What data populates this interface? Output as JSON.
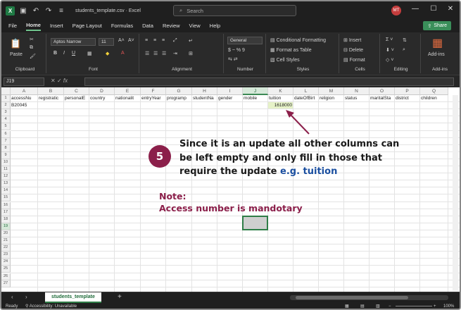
{
  "app": {
    "logo_letter": "X",
    "document_title": "students_template.csv  ·  Excel",
    "search_placeholder": "Search",
    "user_initials": "MT",
    "window_controls": [
      "—",
      "☐",
      "✕"
    ]
  },
  "menu": {
    "tabs": [
      "File",
      "Home",
      "Insert",
      "Page Layout",
      "Formulas",
      "Data",
      "Review",
      "View",
      "Help"
    ],
    "active_tab": "Home",
    "share_label": "Share"
  },
  "ribbon": {
    "clipboard": {
      "label": "Clipboard",
      "paste": "Paste"
    },
    "font": {
      "label": "Font",
      "font_name": "Aptos Narrow",
      "font_size": "11"
    },
    "alignment": {
      "label": "Alignment"
    },
    "number": {
      "label": "Number",
      "format": "General",
      "symbols": "$ ~ %  9"
    },
    "styles": {
      "label": "Styles",
      "items": [
        "Conditional Formatting",
        "Format as Table",
        "Cell Styles"
      ]
    },
    "cells": {
      "label": "Cells",
      "items": [
        "Insert",
        "Delete",
        "Format"
      ]
    },
    "editing": {
      "label": "Editing"
    },
    "addins": {
      "label": "Add-ins",
      "button": "Add-ins"
    }
  },
  "formula_bar": {
    "name_box": "J19",
    "fx_symbol": "fx",
    "value": ""
  },
  "sheet": {
    "columns": [
      "A",
      "B",
      "C",
      "D",
      "E",
      "F",
      "G",
      "H",
      "I",
      "J",
      "K",
      "L",
      "M",
      "N",
      "O",
      "P",
      "Q"
    ],
    "selected_column": "J",
    "selected_row": 19,
    "rows": [
      1,
      2,
      3,
      4,
      5,
      6,
      7,
      8,
      9,
      10,
      11,
      12,
      13,
      14,
      15,
      16,
      17,
      18,
      19,
      20,
      21,
      22,
      23,
      24,
      25,
      26,
      27
    ],
    "header_row": [
      "accessNu",
      "registratic",
      "personalE",
      "country",
      "nationalit",
      "entryYear",
      "programp",
      "studentNa",
      "gender",
      "mobile",
      "tuition",
      "dateOfBirt",
      "religion",
      "status",
      "maritalSta",
      "district",
      "children"
    ],
    "row2": {
      "A": "B20045",
      "K": "1618000"
    },
    "active_sheet": "students_template"
  },
  "annotation": {
    "step_number": "5",
    "text_main": "Since it is an update all other columns can be left empty and only fill in those that require the update",
    "text_highlight": "e.g. tuition",
    "note_title": "Note:",
    "note_text": "Access number is mandotary",
    "colors": {
      "badge": "#8b1f4a",
      "highlight": "#1b4fa0",
      "note": "#8b1f4a",
      "arrow": "#8b1f4a"
    }
  },
  "status": {
    "ready": "Ready",
    "accessibility": "Accessibility: Unavailable",
    "zoom": "100%"
  }
}
